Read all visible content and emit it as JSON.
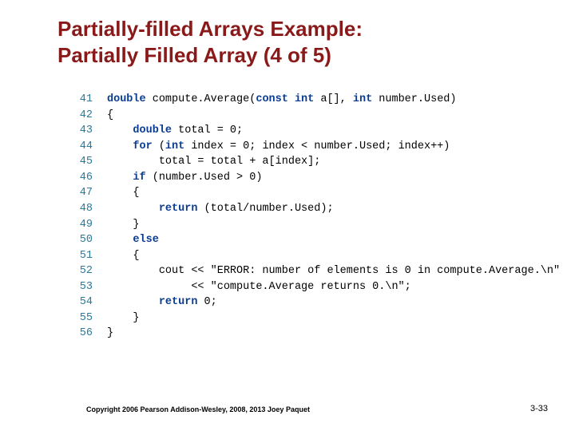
{
  "title_line1": "Partially-filled Arrays Example:",
  "title_line2": "Partially Filled Array (4 of 5)",
  "code": {
    "lines": [
      {
        "num": "41",
        "indent": 0,
        "tokens": [
          {
            "t": "double ",
            "c": "kw"
          },
          {
            "t": "compute.Average(",
            "c": "txt"
          },
          {
            "t": "const int ",
            "c": "kw"
          },
          {
            "t": "a[], ",
            "c": "txt"
          },
          {
            "t": "int ",
            "c": "kw"
          },
          {
            "t": "number.Used)",
            "c": "txt"
          }
        ]
      },
      {
        "num": "42",
        "indent": 0,
        "tokens": [
          {
            "t": "{",
            "c": "txt"
          }
        ]
      },
      {
        "num": "43",
        "indent": 1,
        "tokens": [
          {
            "t": "double ",
            "c": "kw"
          },
          {
            "t": "total = 0;",
            "c": "txt"
          }
        ]
      },
      {
        "num": "44",
        "indent": 1,
        "tokens": [
          {
            "t": "for ",
            "c": "kw"
          },
          {
            "t": "(",
            "c": "txt"
          },
          {
            "t": "int ",
            "c": "kw"
          },
          {
            "t": "index = 0; index < number.Used; index++)",
            "c": "txt"
          }
        ]
      },
      {
        "num": "45",
        "indent": 2,
        "tokens": [
          {
            "t": "total = total + a[index];",
            "c": "txt"
          }
        ]
      },
      {
        "num": "46",
        "indent": 1,
        "tokens": [
          {
            "t": "if ",
            "c": "kw"
          },
          {
            "t": "(number.Used > 0)",
            "c": "txt"
          }
        ]
      },
      {
        "num": "47",
        "indent": 1,
        "tokens": [
          {
            "t": "{",
            "c": "txt"
          }
        ]
      },
      {
        "num": "48",
        "indent": 2,
        "tokens": [
          {
            "t": "return ",
            "c": "kw"
          },
          {
            "t": "(total/number.Used);",
            "c": "txt"
          }
        ]
      },
      {
        "num": "49",
        "indent": 1,
        "tokens": [
          {
            "t": "}",
            "c": "txt"
          }
        ]
      },
      {
        "num": "50",
        "indent": 1,
        "tokens": [
          {
            "t": "else",
            "c": "kw"
          }
        ]
      },
      {
        "num": "51",
        "indent": 1,
        "tokens": [
          {
            "t": "{",
            "c": "txt"
          }
        ]
      },
      {
        "num": "52",
        "indent": 2,
        "tokens": [
          {
            "t": "cout << \"ERROR: number of elements is 0 in compute.Average.\\n\"",
            "c": "txt"
          }
        ]
      },
      {
        "num": "53",
        "indent": 2,
        "tokens": [
          {
            "t": "     << \"compute.Average returns 0.\\n\";",
            "c": "txt"
          }
        ]
      },
      {
        "num": "54",
        "indent": 2,
        "tokens": [
          {
            "t": "return ",
            "c": "kw"
          },
          {
            "t": "0;",
            "c": "txt"
          }
        ]
      },
      {
        "num": "55",
        "indent": 1,
        "tokens": [
          {
            "t": "}",
            "c": "txt"
          }
        ]
      },
      {
        "num": "56",
        "indent": 0,
        "tokens": [
          {
            "t": "}",
            "c": "txt"
          }
        ]
      }
    ]
  },
  "footer": {
    "copyright": "Copyright  2006 Pearson Addison-Wesley, 2008, 2013 Joey Paquet",
    "pagenum": "3-33"
  }
}
